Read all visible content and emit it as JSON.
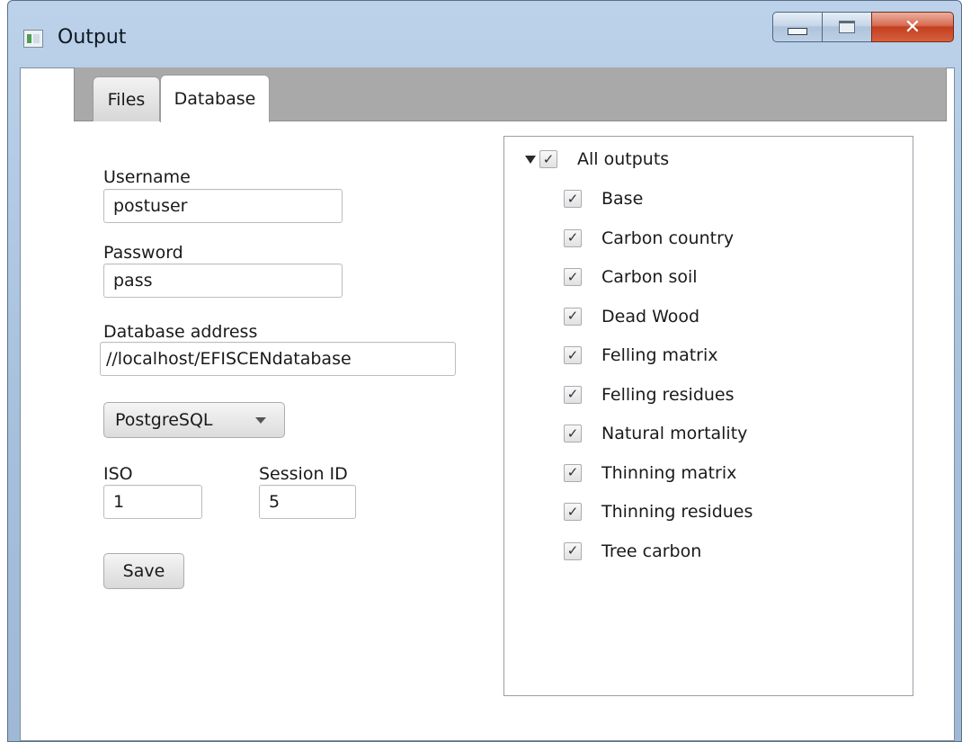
{
  "window": {
    "title": "Output"
  },
  "tabs": [
    {
      "label": "Files",
      "active": false
    },
    {
      "label": "Database",
      "active": true
    }
  ],
  "form": {
    "username_label": "Username",
    "username_value": "postuser",
    "password_label": "Password",
    "password_value": "pass",
    "address_label": "Database address",
    "address_value": "//localhost/EFISCENdatabase",
    "db_type": "PostgreSQL",
    "iso_label": "ISO",
    "iso_value": "1",
    "session_label": "Session ID",
    "session_value": "5",
    "save_label": "Save"
  },
  "tree": {
    "root": {
      "label": "All outputs",
      "checked": true,
      "expanded": true
    },
    "items": [
      {
        "label": "Base",
        "checked": true
      },
      {
        "label": "Carbon country",
        "checked": true
      },
      {
        "label": "Carbon soil",
        "checked": true
      },
      {
        "label": "Dead Wood",
        "checked": true
      },
      {
        "label": "Felling matrix",
        "checked": true
      },
      {
        "label": "Felling residues",
        "checked": true
      },
      {
        "label": "Natural mortality",
        "checked": true
      },
      {
        "label": "Thinning matrix",
        "checked": true
      },
      {
        "label": "Thinning residues",
        "checked": true
      },
      {
        "label": "Tree carbon",
        "checked": true
      }
    ],
    "check_glyph": "✓"
  },
  "icons": {
    "close_glyph": "✕"
  },
  "colors": {
    "tab_strip": "#a9a9a9",
    "close_button": "#c2401f"
  }
}
